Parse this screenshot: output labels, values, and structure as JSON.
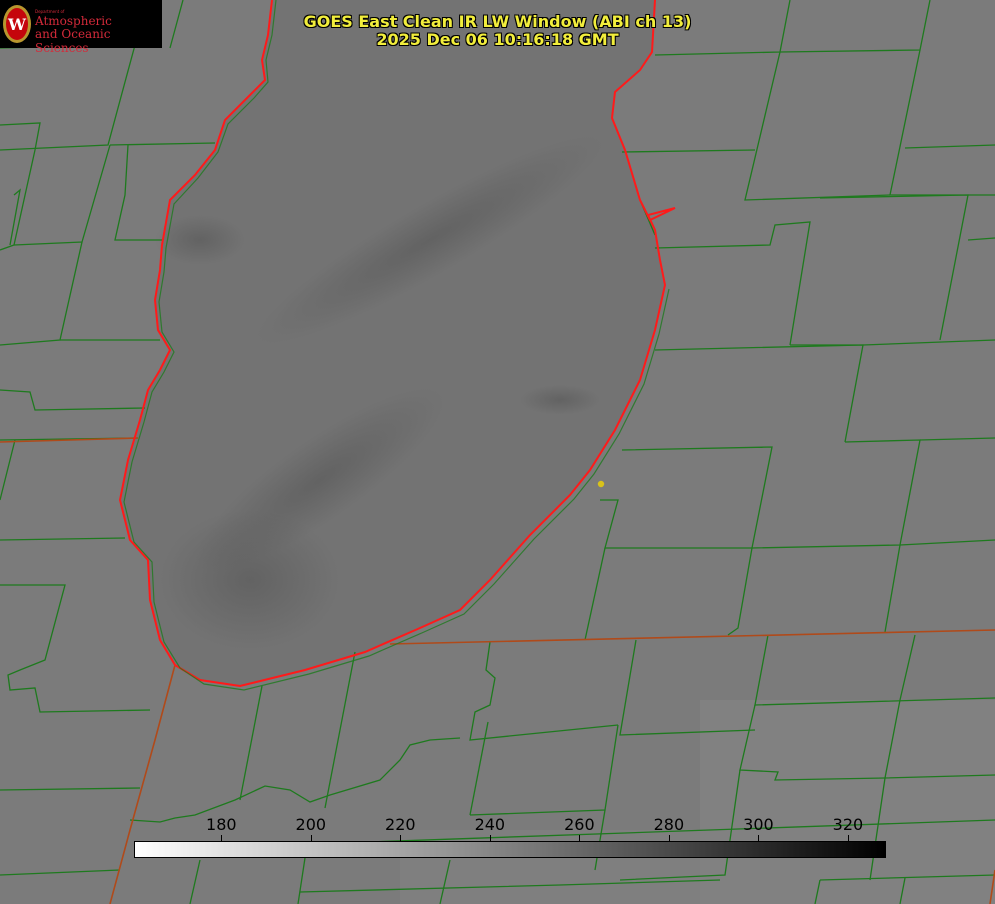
{
  "title": {
    "line1": "GOES East Clean IR LW Window (ABI ch 13)",
    "line2": "2025 Dec 06 10:16:18 GMT"
  },
  "logo": {
    "department": "Department of",
    "line1": "Atmospheric",
    "line2": "and Oceanic Sciences"
  },
  "colorbar": {
    "ticks": [
      180,
      200,
      220,
      240,
      260,
      280,
      300,
      320
    ],
    "min": 160.5,
    "max": 328.5,
    "colors": [
      "#ffffff",
      "#000000"
    ]
  },
  "colors": {
    "background": "#7a7a7a",
    "lake": "#6f6f6f",
    "county_lines": "#1e7a1e",
    "state_lines": "#b04a1a",
    "coastline": "#ff1a1a",
    "title": "#f2ee3c",
    "marker": "#d8c21a"
  },
  "icons": {
    "logo": "uw-seal-icon",
    "marker": "station-dot-icon"
  }
}
